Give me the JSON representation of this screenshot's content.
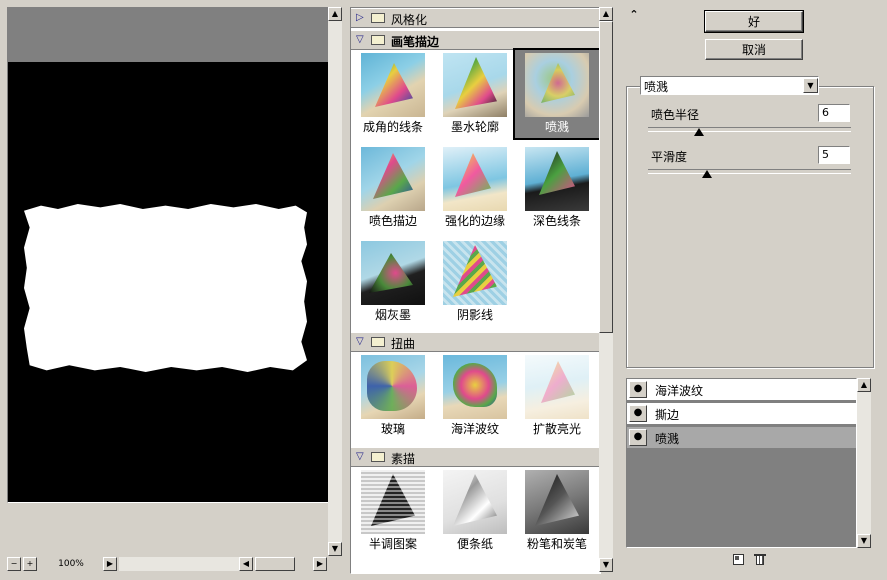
{
  "preview": {
    "zoom": "100%",
    "zoom_out": "−",
    "zoom_in": "+"
  },
  "gallery": {
    "categories": [
      {
        "name": "风格化",
        "expanded": false
      },
      {
        "name": "画笔描边",
        "expanded": true,
        "filters": [
          "成角的线条",
          "墨水轮廓",
          "喷溅",
          "喷色描边",
          "强化的边缘",
          "深色线条",
          "烟灰墨",
          "阴影线"
        ],
        "selected": "喷溅"
      },
      {
        "name": "扭曲",
        "expanded": true,
        "filters": [
          "玻璃",
          "海洋波纹",
          "扩散亮光"
        ]
      },
      {
        "name": "素描",
        "expanded": true,
        "filters": [
          "半调图案",
          "便条纸",
          "粉笔和炭笔"
        ]
      }
    ]
  },
  "buttons": {
    "ok": "好",
    "cancel": "取消"
  },
  "filter_select": {
    "value": "喷溅"
  },
  "params": [
    {
      "label": "喷色半径",
      "value": "6",
      "slider_fraction": 0.25
    },
    {
      "label": "平滑度",
      "value": "5",
      "slider_fraction": 0.29
    }
  ],
  "layers": [
    {
      "name": "海洋波纹",
      "selected": false
    },
    {
      "name": "撕边",
      "selected": false
    },
    {
      "name": "喷溅",
      "selected": true
    }
  ],
  "icons": {
    "collapse": "double-chevron-up-icon",
    "new_layer": "new-layer-icon",
    "delete_layer": "trash-icon",
    "eye": "eye-icon"
  }
}
